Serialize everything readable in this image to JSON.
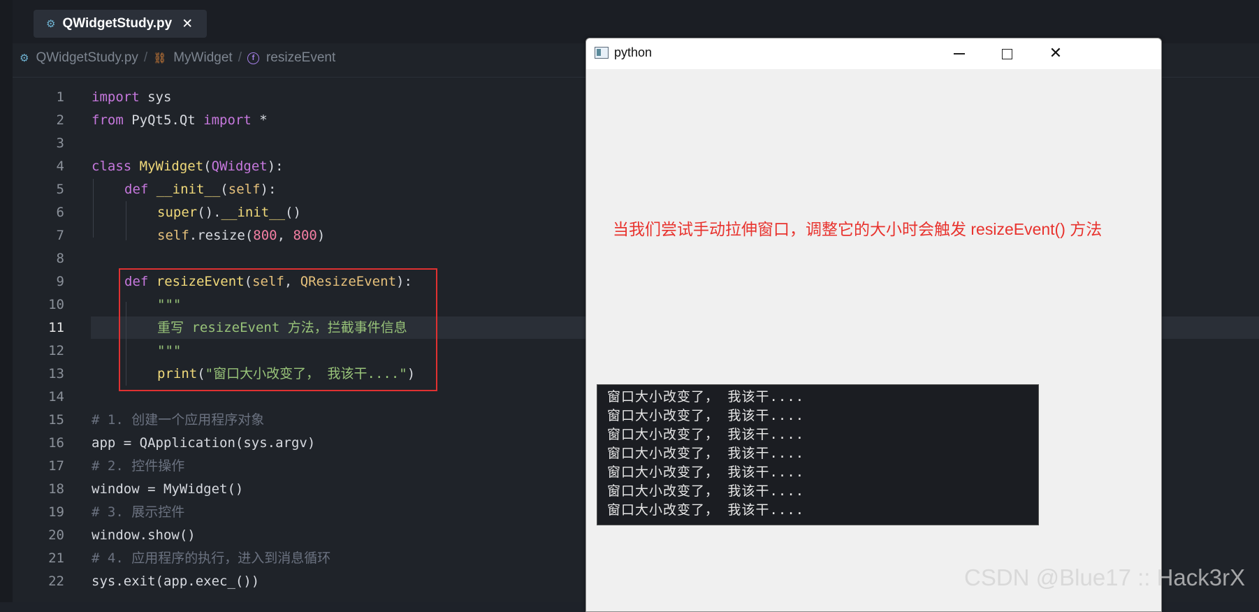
{
  "editor": {
    "tab": {
      "filename": "QWidgetStudy.py",
      "close_glyph": "✕"
    },
    "breadcrumb": {
      "file": "QWidgetStudy.py",
      "class": "MyWidget",
      "method": "resizeEvent",
      "separator": "/"
    },
    "line_numbers": [
      "1",
      "2",
      "3",
      "4",
      "5",
      "6",
      "7",
      "8",
      "9",
      "10",
      "11",
      "12",
      "13",
      "14",
      "15",
      "16",
      "17",
      "18",
      "19",
      "20",
      "21",
      "22"
    ],
    "active_line": "11",
    "code": {
      "l1": [
        "import",
        " sys"
      ],
      "l2": [
        "from",
        " PyQt5.Qt ",
        "import",
        " *"
      ],
      "l4": [
        "class",
        " ",
        "MyWidget",
        "(",
        "QWidget",
        "):"
      ],
      "l5": [
        "def",
        " ",
        "__init__",
        "(",
        "self",
        "):"
      ],
      "l6": [
        "super",
        "().",
        "__init__",
        "()"
      ],
      "l7": [
        "self",
        ".resize(",
        "800",
        ", ",
        "800",
        ")"
      ],
      "l9": [
        "def",
        " ",
        "resizeEvent",
        "(",
        "self",
        ", ",
        "QResizeEvent",
        "):"
      ],
      "l10": "\"\"\"",
      "l11": "重写 resizeEvent 方法，拦截事件信息",
      "l12": "\"\"\"",
      "l13": [
        "print",
        "(",
        "\"窗口大小改变了， 我该干....\"",
        ")"
      ],
      "l15": "# 1. 创建一个应用程序对象",
      "l16": "app = QApplication(sys.argv)",
      "l17": "# 2. 控件操作",
      "l18": "window = MyWidget()",
      "l19": "# 3. 展示控件",
      "l20": "window.show()",
      "l21": "# 4. 应用程序的执行，进入到消息循环",
      "l22": "sys.exit(app.exec_())"
    }
  },
  "python_window": {
    "title": "python",
    "minimize_label": "—",
    "maximize_label": "☐",
    "close_label": "✕",
    "message": "当我们尝试手动拉伸窗口，调整它的大小时会触发 resizeEvent() 方法"
  },
  "console": {
    "lines": [
      "窗口大小改变了， 我该干....",
      "窗口大小改变了， 我该干....",
      "窗口大小改变了， 我该干....",
      "窗口大小改变了， 我该干....",
      "窗口大小改变了， 我该干....",
      "窗口大小改变了， 我该干....",
      "窗口大小改变了， 我该干...."
    ]
  },
  "watermark": "CSDN @Blue17 :: Hack3rX",
  "colors": {
    "editor_bg": "#1f2329",
    "keyword": "#c678dd",
    "string": "#98c379",
    "number": "#f47fa3",
    "highlight_box": "#e03131",
    "message_text": "#e8332e"
  }
}
